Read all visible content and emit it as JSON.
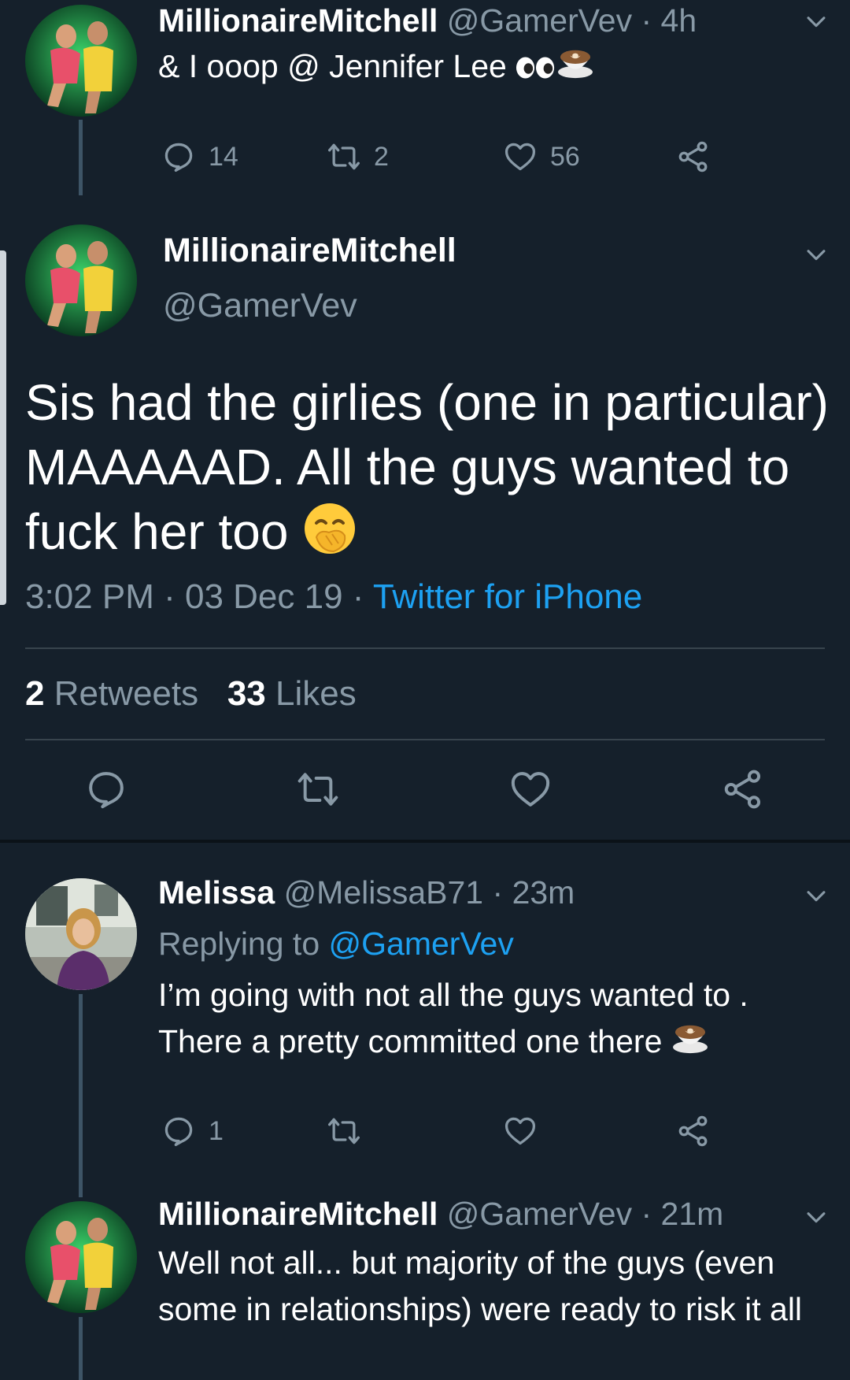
{
  "tweet1": {
    "name": "MillionaireMitchell",
    "handle": "@GamerVev",
    "dot": " · ",
    "time": "4h",
    "text": "& I ooop @ Jennifer Lee",
    "replies": "14",
    "retweets": "2",
    "likes": "56"
  },
  "main_tweet": {
    "name": "MillionaireMitchell",
    "handle": "@GamerVev",
    "text": "Sis had the girlies (one in particular) MAAAAAD. All the guys wanted to fuck her too",
    "time": "3:02 PM",
    "date": "03 Dec 19",
    "sep": " · ",
    "source": "Twitter for iPhone",
    "retweet_count": "2",
    "retweet_label": " Retweets",
    "like_count": "33",
    "like_label": " Likes"
  },
  "reply1": {
    "name": "Melissa",
    "handle": "@MelissaB71",
    "dot": " · ",
    "time": "23m",
    "replying_label": "Replying to ",
    "replying_to": "@GamerVev",
    "text": "I’m going with not all the guys wanted to . There a pretty committed one there",
    "replies": "1"
  },
  "reply2": {
    "name": "MillionaireMitchell",
    "handle": "@GamerVev",
    "dot": " · ",
    "time": "21m",
    "text": "Well not all... but majority of the guys (even some in relationships) were ready to risk it all"
  },
  "icons": {
    "reply": "reply-icon",
    "retweet": "retweet-icon",
    "like": "heart-icon",
    "share": "share-icon",
    "more": "chevron-down-icon",
    "eyes": "eyes-emoji",
    "coffee": "coffee-emoji",
    "hand_over_mouth": "face-with-hand-over-mouth-emoji"
  },
  "colors": {
    "background": "#15202b",
    "accent": "#1da1f2",
    "secondary_text": "#8899a6",
    "divider": "#38444d"
  }
}
